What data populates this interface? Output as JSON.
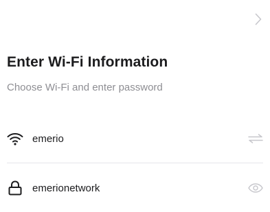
{
  "header": {
    "title": "Enter Wi-Fi Information",
    "subtitle": "Choose Wi-Fi and enter password"
  },
  "wifi": {
    "network_name": "emerio",
    "icon": "wifi-icon",
    "action_icon": "switch-network-icon"
  },
  "password": {
    "value": "emerionetwork",
    "icon": "lock-icon",
    "action_icon": "eye-icon"
  },
  "nav": {
    "next_icon": "chevron-right-icon"
  },
  "colors": {
    "title": "#1c1c1e",
    "subtitle": "#8e8e93",
    "icon_muted": "#c7c7cc",
    "divider": "#e5e5ea"
  }
}
